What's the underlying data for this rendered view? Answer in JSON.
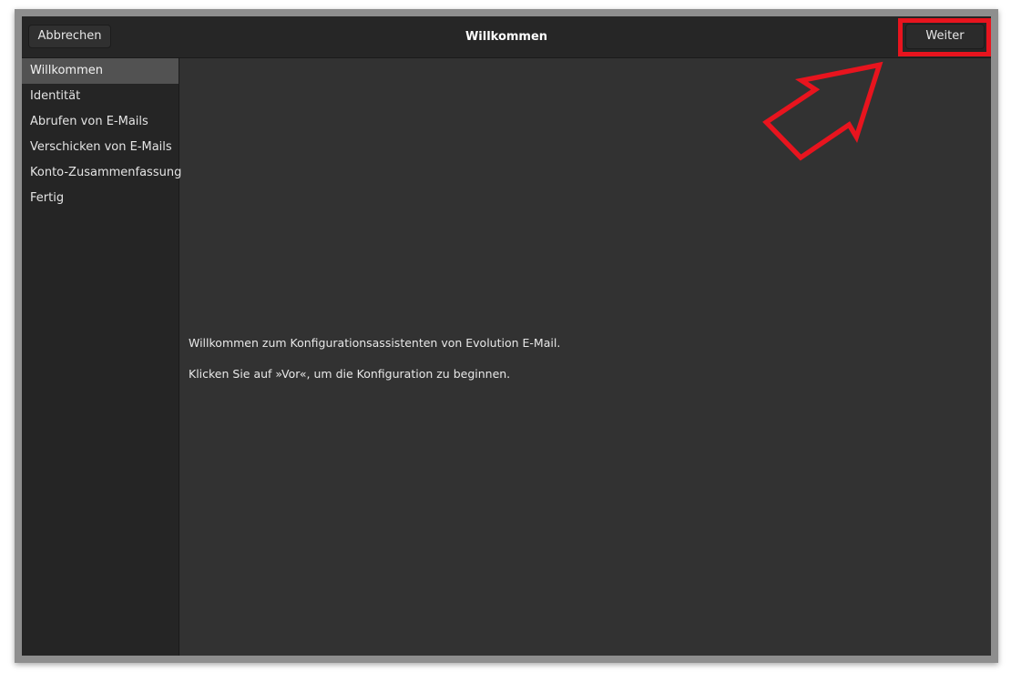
{
  "window": {
    "title": "Willkommen"
  },
  "headerbar": {
    "cancel_label": "Abbrechen",
    "next_label": "Weiter"
  },
  "sidebar": {
    "items": [
      {
        "label": "Willkommen",
        "active": true
      },
      {
        "label": "Identität",
        "active": false
      },
      {
        "label": "Abrufen von E-Mails",
        "active": false
      },
      {
        "label": "Verschicken von E-Mails",
        "active": false
      },
      {
        "label": "Konto-Zusammenfassung",
        "active": false
      },
      {
        "label": "Fertig",
        "active": false
      }
    ]
  },
  "content": {
    "welcome_text": "Willkommen zum Konfigurationsassistenten von Evolution E-Mail.",
    "instruction_text": "Klicken Sie auf »Vor«, um die Konfiguration zu beginnen."
  },
  "annotation": {
    "color": "#e8141e",
    "arrow_icon": "arrow-up-right-outline-icon",
    "highlight": "next-button"
  },
  "colors": {
    "window_bg": "#323232",
    "headerbar_bg": "#262626",
    "sidebar_bg": "#252525",
    "sidebar_active_bg": "#525252"
  }
}
